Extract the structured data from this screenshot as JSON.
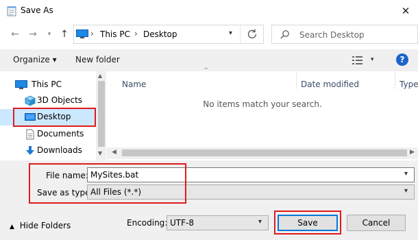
{
  "window": {
    "title": "Save As",
    "close_label": "✕"
  },
  "address": {
    "segments": [
      "This PC",
      "Desktop"
    ]
  },
  "search": {
    "placeholder": "Search Desktop"
  },
  "toolbar": {
    "organize": "Organize ▾",
    "new_folder": "New folder",
    "help": "?"
  },
  "nav_pane": {
    "items": [
      {
        "label": "This PC",
        "icon": "pc-icon"
      },
      {
        "label": "3D Objects",
        "icon": "cube-icon"
      },
      {
        "label": "Desktop",
        "icon": "desktop-icon",
        "selected": true
      },
      {
        "label": "Documents",
        "icon": "document-icon"
      },
      {
        "label": "Downloads",
        "icon": "download-icon"
      }
    ]
  },
  "columns": [
    "Name",
    "Date modified",
    "Type"
  ],
  "empty_message": "No items match your search.",
  "form": {
    "file_name_label": "File name:",
    "file_name_value": "MySites.bat",
    "save_type_label": "Save as type:",
    "save_type_value": "All Files  (*.*)",
    "encoding_label": "Encoding:",
    "encoding_value": "UTF-8"
  },
  "footer": {
    "hide_folders": "Hide Folders",
    "save": "Save",
    "cancel": "Cancel"
  },
  "colors": {
    "accent": "#0078d7",
    "highlight": "#e0191e",
    "selection": "#cce8ff"
  }
}
